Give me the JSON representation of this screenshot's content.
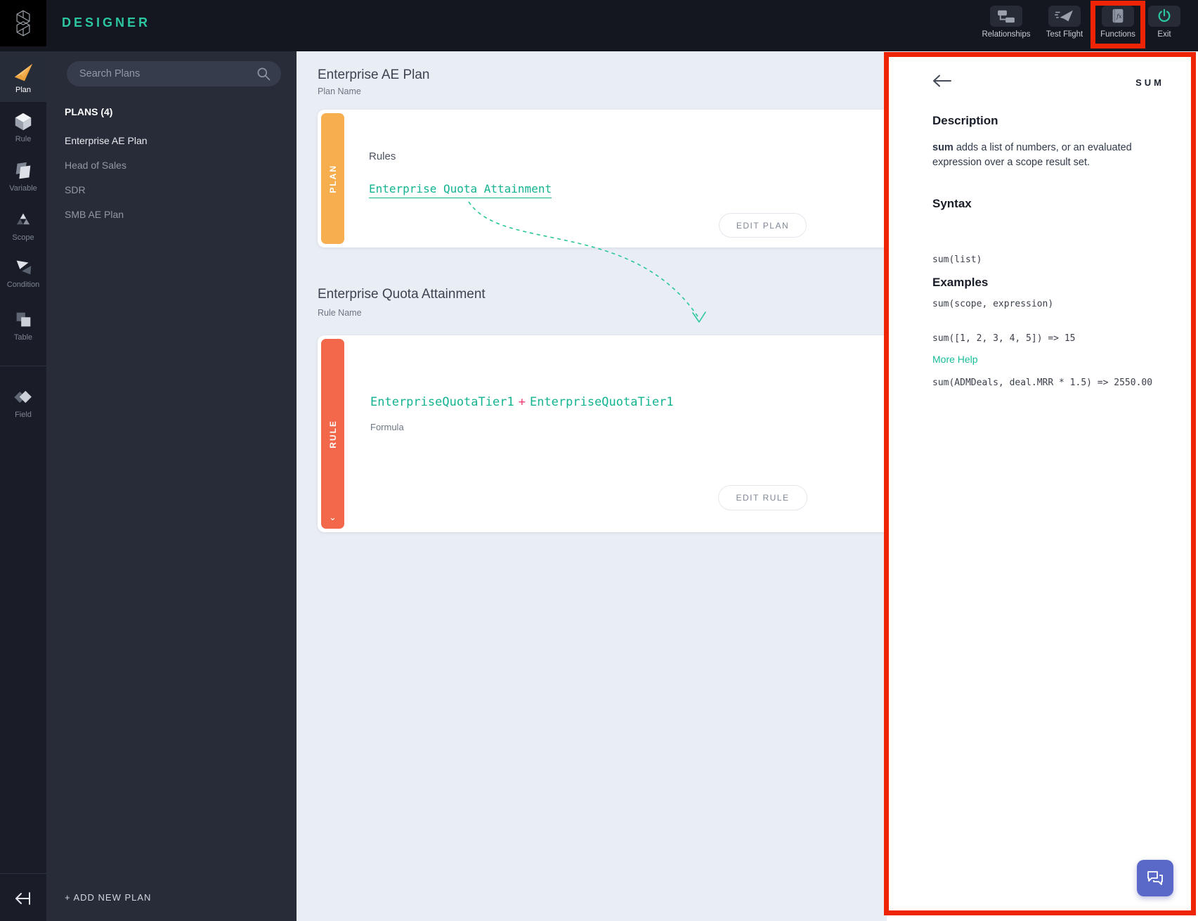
{
  "header": {
    "app_title": "DESIGNER",
    "nav": [
      {
        "label": "Relationships"
      },
      {
        "label": "Test Flight"
      },
      {
        "label": "Functions"
      },
      {
        "label": "Exit"
      }
    ]
  },
  "rail": {
    "items": [
      {
        "label": "Plan"
      },
      {
        "label": "Rule"
      },
      {
        "label": "Variable"
      },
      {
        "label": "Scope"
      },
      {
        "label": "Condition"
      },
      {
        "label": "Table"
      },
      {
        "label": "Field"
      }
    ]
  },
  "plans_panel": {
    "search_placeholder": "Search Plans",
    "section_title": "PLANS (4)",
    "items": [
      {
        "label": "Enterprise AE Plan"
      },
      {
        "label": "Head of Sales"
      },
      {
        "label": "SDR"
      },
      {
        "label": "SMB AE Plan"
      }
    ],
    "add_button": "+ ADD NEW PLAN"
  },
  "plan_section": {
    "title": "Enterprise AE Plan",
    "subtitle": "Plan Name",
    "tab": "PLAN",
    "rules_label": "Rules",
    "rule_link": "Enterprise Quota Attainment",
    "edit_button": "EDIT PLAN"
  },
  "rule_section": {
    "title": "Enterprise Quota Attainment",
    "subtitle": "Rule Name",
    "tab": "RULE",
    "formula_left": "EnterpriseQuotaTier1",
    "formula_operator": "+",
    "formula_right": "EnterpriseQuotaTier1",
    "formula_label": "Formula",
    "edit_button": "EDIT RULE"
  },
  "function_panel": {
    "name": "SUM",
    "description_heading": "Description",
    "description_bold": "sum",
    "description_rest": " adds a list of numbers, or an evaluated expression over a scope result set.",
    "syntax_heading": "Syntax",
    "syntax_lines": [
      "sum(list)",
      "sum(scope, expression)"
    ],
    "examples_heading": "Examples",
    "example_lines": [
      "sum([1, 2, 3, 4, 5]) => 15",
      "sum(ADMDeals, deal.MRR * 1.5) => 2550.00"
    ],
    "more_help": "More Help"
  },
  "colors": {
    "accent_teal": "#2cc6a0",
    "plan_orange": "#f6ae4f",
    "rule_red": "#f3684b",
    "annotation_red": "#ee2405",
    "chat_indigo": "#5a69c7"
  }
}
